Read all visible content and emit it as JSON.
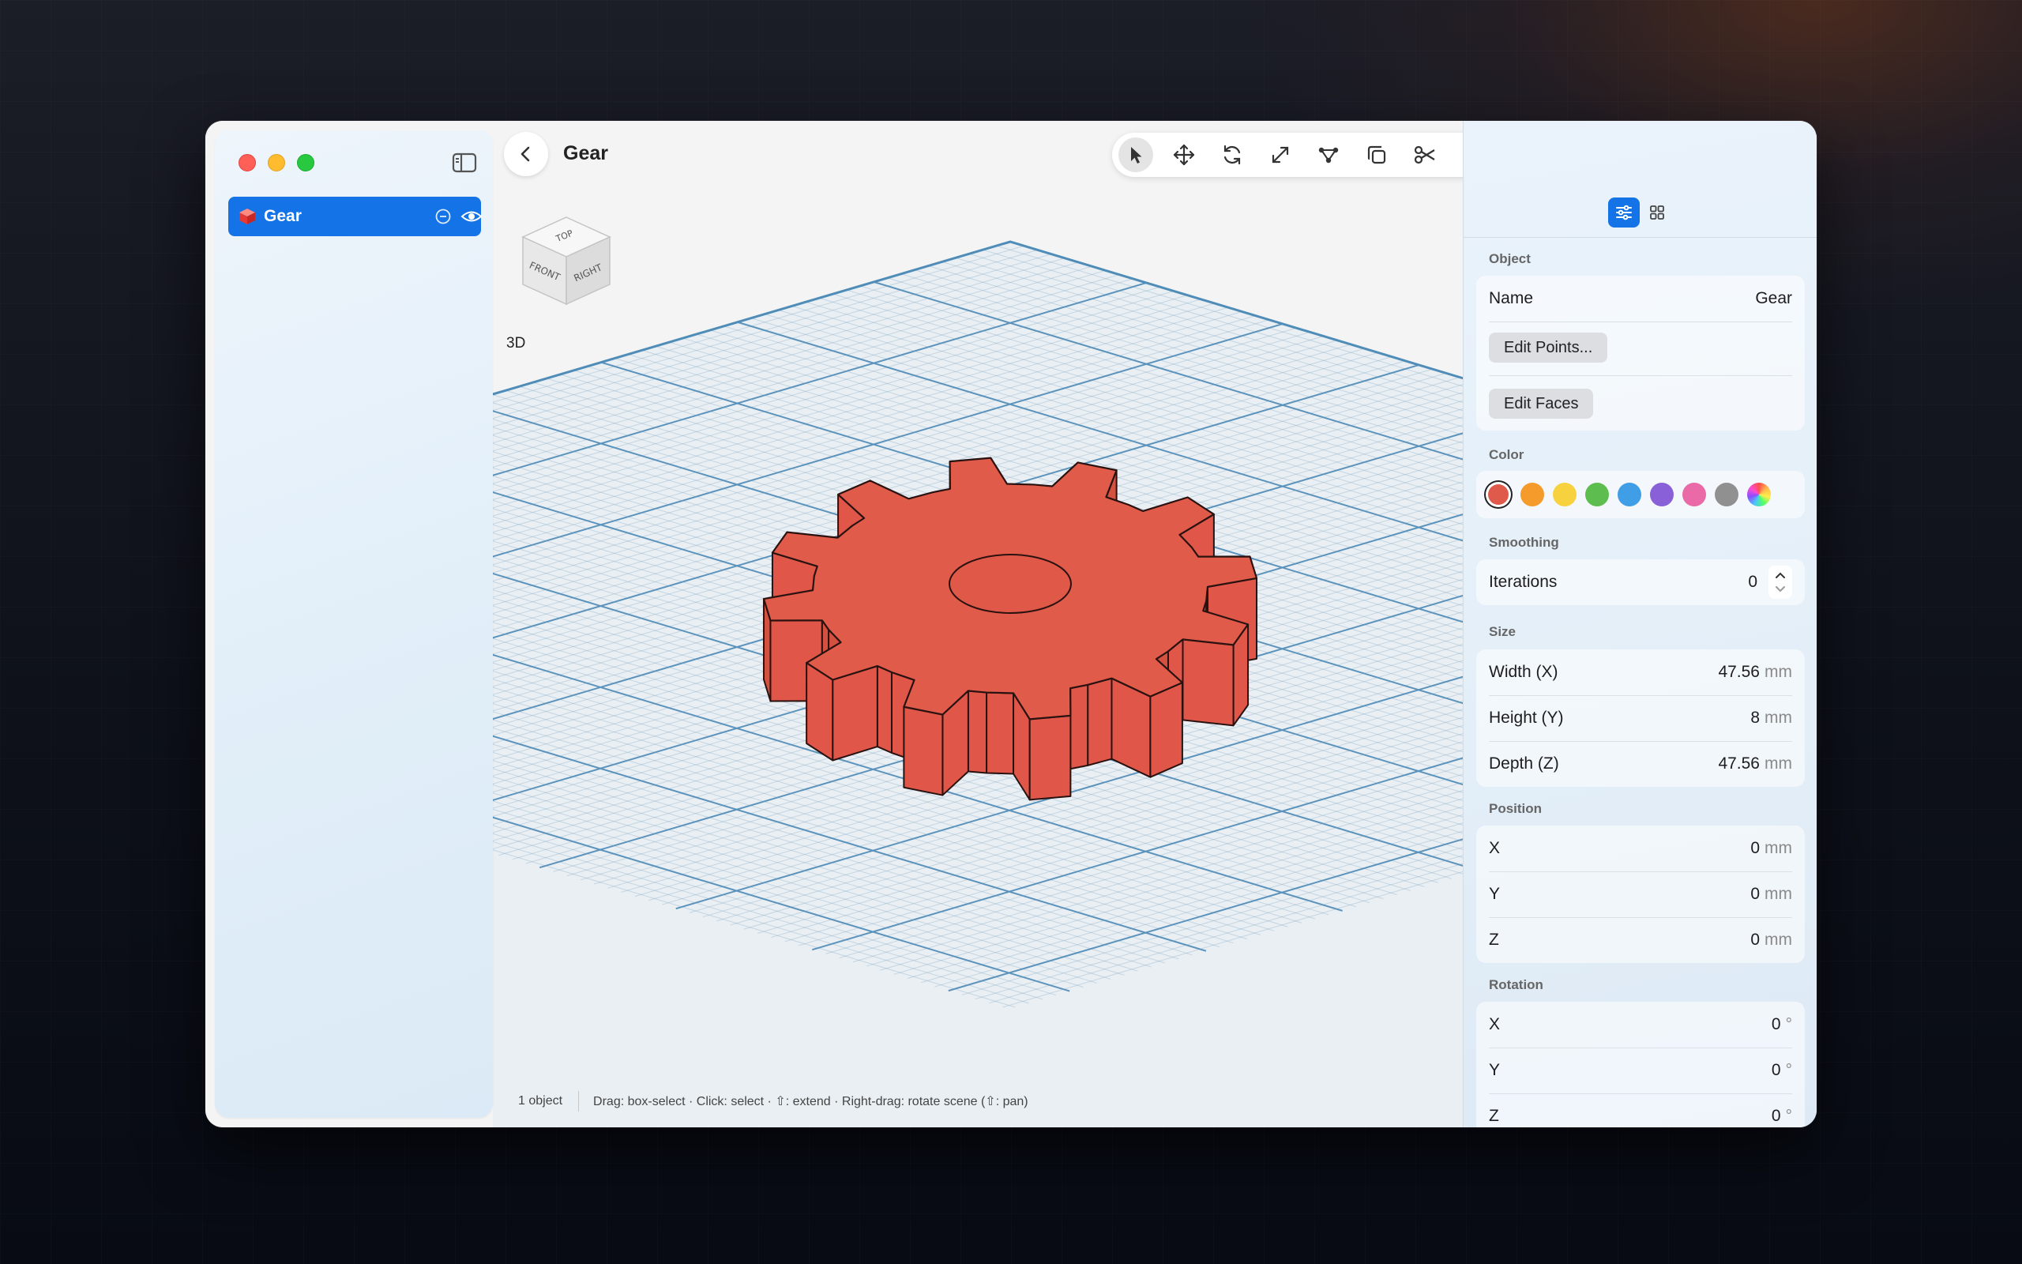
{
  "document": {
    "title": "Gear"
  },
  "sidebar": {
    "objects": [
      {
        "name": "Gear"
      }
    ]
  },
  "viewport": {
    "view_mode": "3D",
    "view_cube": {
      "top": "TOP",
      "front": "FRONT",
      "right": "RIGHT"
    }
  },
  "toolbar": {
    "tools": [
      "select-arrow-icon",
      "move-icon",
      "rotate-icon",
      "scale-icon",
      "edit-vertices-icon",
      "duplicate-icon",
      "cut-icon",
      "measure-angle-icon",
      "ruler-icon"
    ],
    "right_tools": [
      "boolean-icon",
      "subtract-icon",
      "shading-icon",
      "crosshair-icon",
      "inspector-toggle-icon"
    ]
  },
  "status": {
    "count": "1 object",
    "hint": "Drag: box-select · Click: select · ⇧: extend · Right-drag: rotate scene (⇧: pan)"
  },
  "inspector": {
    "object": {
      "title": "Object",
      "name_label": "Name",
      "name_value": "Gear",
      "edit_points": "Edit Points...",
      "edit_faces": "Edit Faces"
    },
    "color": {
      "title": "Color",
      "swatches": [
        "#e05a4b",
        "#f59b2b",
        "#f7d23e",
        "#5dbe4f",
        "#3f9ee5",
        "#8a60d8",
        "#ea6aa8",
        "#909090",
        "rainbow"
      ],
      "selected": "#e05a4b"
    },
    "smoothing": {
      "title": "Smoothing",
      "label": "Iterations",
      "value": "0"
    },
    "size": {
      "title": "Size",
      "width_label": "Width (X)",
      "width_value": "47.56",
      "height_label": "Height (Y)",
      "height_value": "8",
      "depth_label": "Depth (Z)",
      "depth_value": "47.56",
      "unit": "mm"
    },
    "position": {
      "title": "Position",
      "x_label": "X",
      "x_value": "0",
      "y_label": "Y",
      "y_value": "0",
      "z_label": "Z",
      "z_value": "0",
      "unit": "mm"
    },
    "rotation": {
      "title": "Rotation",
      "x_label": "X",
      "x_value": "0",
      "y_label": "Y",
      "y_value": "0",
      "z_label": "Z",
      "z_value": "0",
      "unit": "°"
    }
  }
}
